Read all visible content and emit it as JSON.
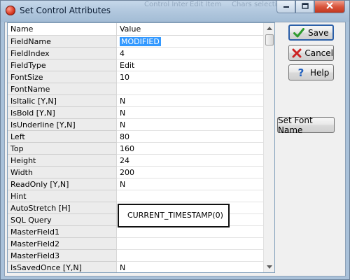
{
  "window": {
    "title": "Set Control Attributes",
    "background_hints": [
      "Control Inter",
      "Edit Item",
      "Chars selection"
    ]
  },
  "grid": {
    "headers": {
      "name": "Name",
      "value": "Value"
    },
    "rows": [
      {
        "name": "FieldName",
        "value": "MODIFIED"
      },
      {
        "name": "FieldIndex",
        "value": "4"
      },
      {
        "name": "FieldType",
        "value": "Edit"
      },
      {
        "name": "FontSize",
        "value": "10"
      },
      {
        "name": "FontName",
        "value": ""
      },
      {
        "name": "IsItalic [Y,N]",
        "value": "N"
      },
      {
        "name": "IsBold [Y,N]",
        "value": "N"
      },
      {
        "name": "IsUnderline [Y,N]",
        "value": "N"
      },
      {
        "name": "Left",
        "value": "80"
      },
      {
        "name": "Top",
        "value": "160"
      },
      {
        "name": "Height",
        "value": "24"
      },
      {
        "name": "Width",
        "value": "200"
      },
      {
        "name": "ReadOnly [Y,N]",
        "value": "N"
      },
      {
        "name": "Hint",
        "value": ""
      },
      {
        "name": "AutoStretch [H]",
        "value": ""
      },
      {
        "name": "SQL Query",
        "value": ""
      },
      {
        "name": "MasterField1",
        "value": ""
      },
      {
        "name": "MasterField2",
        "value": ""
      },
      {
        "name": "MasterField3",
        "value": ""
      },
      {
        "name": "IsSavedOnce [Y,N]",
        "value": "N"
      }
    ],
    "editor_value": "CURRENT_TIMESTAMP(0)"
  },
  "buttons": {
    "save": "Save",
    "cancel": "Cancel",
    "help": "Help",
    "set_font_name": "Set Font Name"
  },
  "colors": {
    "titlebar": "#b3c9df",
    "selection": "#3399ff",
    "save_icon": "#2e9b2e",
    "cancel_icon": "#cc2222",
    "help_icon": "#1f5fbf",
    "close_button": "#d9563d"
  },
  "icons": {
    "app": "app-icon",
    "save": "checkmark-icon",
    "cancel": "x-icon",
    "help": "question-mark-icon"
  }
}
